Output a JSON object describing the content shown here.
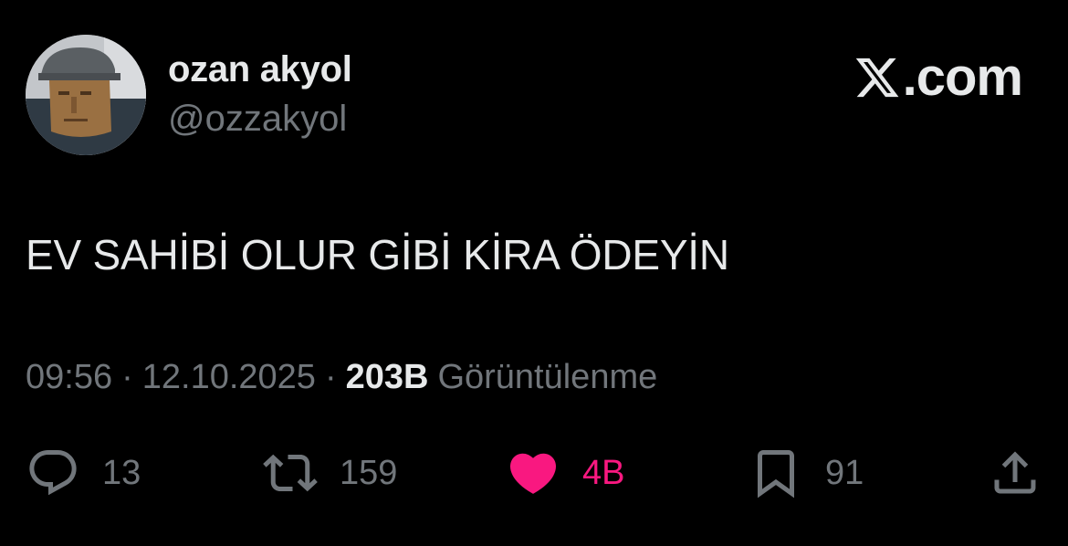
{
  "author": {
    "display_name": "ozan akyol",
    "handle": "@ozzakyol",
    "avatar": "avatar-photo"
  },
  "brand": {
    "logo_icon": "x-logo-icon",
    "text": ".com"
  },
  "tweet": {
    "text": "EV SAHİBİ OLUR GİBİ KİRA ÖDEYİN"
  },
  "meta": {
    "time": "09:56",
    "separator": "·",
    "date": "12.10.2025",
    "views_count": "203B",
    "views_label": "Görüntülenme"
  },
  "actions": {
    "reply": {
      "icon": "reply-icon",
      "count": "13"
    },
    "retweet": {
      "icon": "retweet-icon",
      "count": "159"
    },
    "like": {
      "icon": "heart-icon",
      "count": "4B"
    },
    "bookmark": {
      "icon": "bookmark-icon",
      "count": "91"
    },
    "share": {
      "icon": "share-icon"
    }
  },
  "colors": {
    "background": "#000000",
    "primary_text": "#e7e9ea",
    "secondary_text": "#71767b",
    "like_active": "#f91880"
  }
}
